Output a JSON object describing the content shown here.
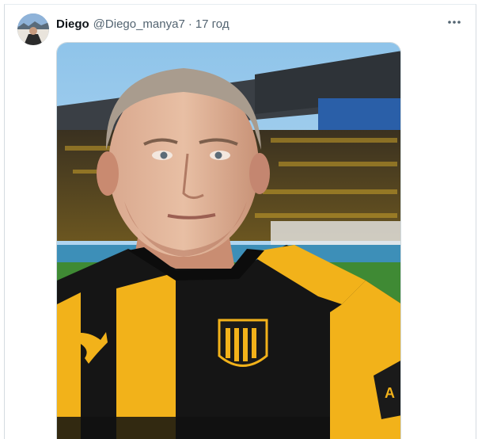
{
  "tweet": {
    "author_name": "Diego",
    "author_handle": "@Diego_manya7",
    "separator": "·",
    "time": "17 год",
    "avatar_icon": "avatar-image",
    "more_icon": "more-horizontal-icon",
    "image_icon": "photo-man-in-yellow-black-striped-shirt-stadium"
  },
  "colors": {
    "text_primary": "#0f1419",
    "text_secondary": "#536471",
    "jersey_yellow": "#f2b21a",
    "jersey_black": "#151515"
  }
}
